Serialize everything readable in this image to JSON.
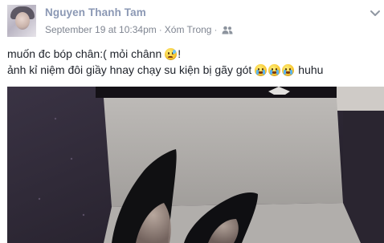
{
  "post": {
    "author": "Nguyen Thanh Tam",
    "timestamp": "September 19 at 10:34pm",
    "separator": "·",
    "location": "Xóm Trong",
    "audience_icon": "friends-icon",
    "menu_icon": "chevron-down-icon",
    "text_line1_a": "muốn đc bóp chân:( mỏi chânn",
    "text_line1_b": "!",
    "text_line2_a": "ảnh kỉ niệm đôi giầy hnay chạy su kiện bị gãy gót",
    "text_line2_b": "huhu",
    "emojis": [
      "sad-face-emoji",
      "crying-face-emoji",
      "crying-face-emoji",
      "crying-face-emoji"
    ]
  },
  "colors": {
    "author": "#8b98b4",
    "meta": "#7f8591",
    "text": "#1d2129"
  }
}
